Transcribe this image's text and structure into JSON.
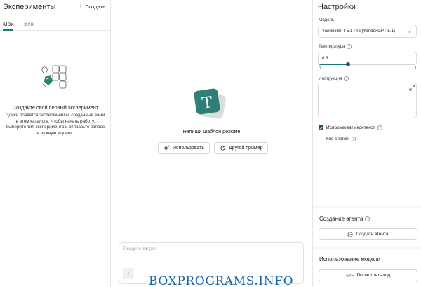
{
  "experiments": {
    "title": "Эксперименты",
    "create_label": "Создать",
    "tabs": [
      {
        "label": "Мои",
        "active": true
      },
      {
        "label": "Все",
        "active": false
      }
    ],
    "empty_title": "Создайте свой первый эксперимент",
    "empty_description": "Здесь появятся эксперименты, созданные вами в этом каталоге. Чтобы начать работу, выберите тип эксперимента и отправьте запрос в нужную модель."
  },
  "template": {
    "name": "Напиши шаблон резюме",
    "use_label": "Использовать",
    "other_label": "Другой пример"
  },
  "prompt": {
    "placeholder": "Введите запрос"
  },
  "settings": {
    "title": "Настройки",
    "model_label": "Модель",
    "model_value": "YandexGPT 5.1 Pro (YandexGPT 5.1)",
    "temperature_label": "Температура",
    "temperature_value": "0.3",
    "temperature_fraction": 0.3,
    "slider_min": "0",
    "slider_max": "1",
    "instruction_label": "Инструкция",
    "use_context_label": "Использовать контекст",
    "use_context_checked": true,
    "file_search_label": "File search",
    "file_search_checked": false
  },
  "agent": {
    "title": "Создание агента",
    "button_label": "Создать агента"
  },
  "usage": {
    "title": "Использование модели",
    "button_label": "Посмотреть код"
  },
  "watermark": "BOXPROGRAMS.INFO",
  "colors": {
    "accent": "#1e7b74",
    "checkbox": "#1e4f63",
    "watermark": "#1565a8"
  }
}
